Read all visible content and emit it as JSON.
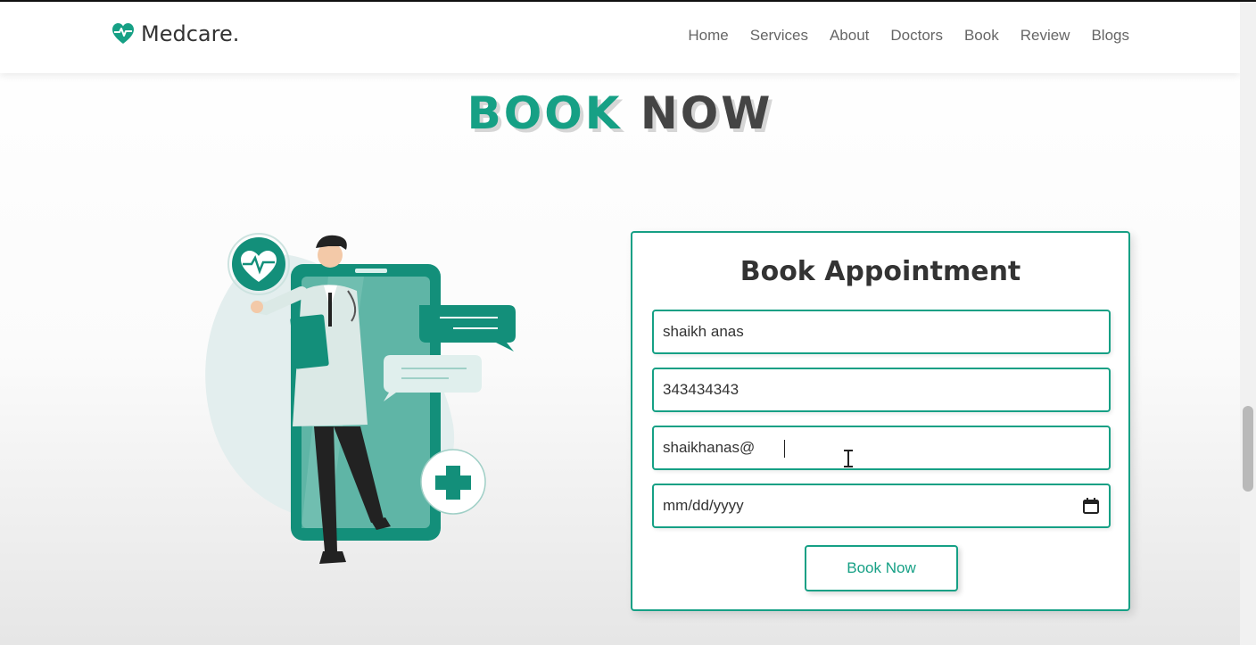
{
  "brand": {
    "name": "Medcare.",
    "icon": "heart-pulse-icon",
    "color": "#16a085"
  },
  "nav": [
    "Home",
    "Services",
    "About",
    "Doctors",
    "Book",
    "Review",
    "Blogs"
  ],
  "section": {
    "title_part1": "BOOK",
    "title_part2": "NOW"
  },
  "form": {
    "title": "Book Appointment",
    "name_value": "shaikh anas",
    "number_value": "343434343",
    "email_value": "shaikhanas@",
    "date_placeholder": "mm/dd/yyyy",
    "submit_label": "Book Now"
  },
  "colors": {
    "accent": "#16a085",
    "text_dark": "#444444"
  }
}
